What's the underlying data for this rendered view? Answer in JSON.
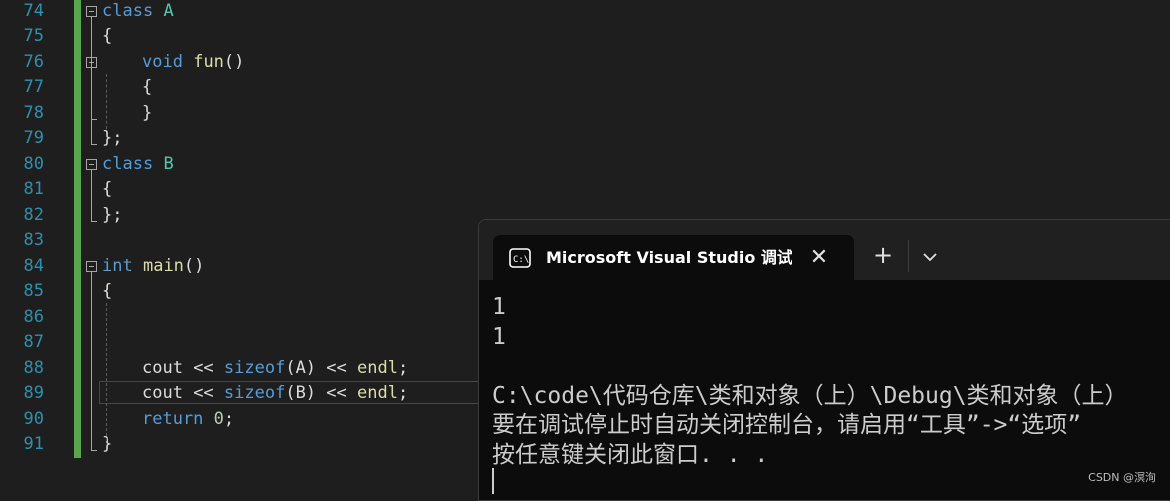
{
  "editor": {
    "lines": [
      {
        "num": "74",
        "indent": 0,
        "tokens": [
          {
            "t": "class",
            "k": "kw"
          },
          {
            "t": " ",
            "k": "txt"
          },
          {
            "t": "A",
            "k": "cls"
          }
        ]
      },
      {
        "num": "75",
        "indent": 0,
        "tokens": [
          {
            "t": "{",
            "k": "txt"
          }
        ]
      },
      {
        "num": "76",
        "indent": 1,
        "tokens": [
          {
            "t": "void",
            "k": "kw"
          },
          {
            "t": " ",
            "k": "txt"
          },
          {
            "t": "fun",
            "k": "fn"
          },
          {
            "t": "()",
            "k": "txt"
          }
        ]
      },
      {
        "num": "77",
        "indent": 1,
        "tokens": [
          {
            "t": "{",
            "k": "txt"
          }
        ]
      },
      {
        "num": "78",
        "indent": 1,
        "tokens": [
          {
            "t": "}",
            "k": "txt"
          }
        ]
      },
      {
        "num": "79",
        "indent": 0,
        "tokens": [
          {
            "t": "};",
            "k": "txt"
          }
        ]
      },
      {
        "num": "80",
        "indent": 0,
        "tokens": [
          {
            "t": "class",
            "k": "kw"
          },
          {
            "t": " ",
            "k": "txt"
          },
          {
            "t": "B",
            "k": "cls"
          }
        ]
      },
      {
        "num": "81",
        "indent": 0,
        "tokens": [
          {
            "t": "{",
            "k": "txt"
          }
        ]
      },
      {
        "num": "82",
        "indent": 0,
        "tokens": [
          {
            "t": "};",
            "k": "txt"
          }
        ]
      },
      {
        "num": "83",
        "indent": 0,
        "tokens": []
      },
      {
        "num": "84",
        "indent": 0,
        "tokens": [
          {
            "t": "int",
            "k": "kw"
          },
          {
            "t": " ",
            "k": "txt"
          },
          {
            "t": "main",
            "k": "fn"
          },
          {
            "t": "()",
            "k": "txt"
          }
        ]
      },
      {
        "num": "85",
        "indent": 0,
        "tokens": [
          {
            "t": "{",
            "k": "txt"
          }
        ]
      },
      {
        "num": "86",
        "indent": 0,
        "tokens": []
      },
      {
        "num": "87",
        "indent": 0,
        "tokens": []
      },
      {
        "num": "88",
        "indent": 1,
        "tokens": [
          {
            "t": "cout",
            "k": "txt"
          },
          {
            "t": " << ",
            "k": "txt"
          },
          {
            "t": "sizeof",
            "k": "kw"
          },
          {
            "t": "(A)",
            "k": "txt"
          },
          {
            "t": " << ",
            "k": "txt"
          },
          {
            "t": "endl",
            "k": "fn"
          },
          {
            "t": ";",
            "k": "txt"
          }
        ]
      },
      {
        "num": "89",
        "indent": 1,
        "tokens": [
          {
            "t": "cout",
            "k": "txt"
          },
          {
            "t": " << ",
            "k": "txt"
          },
          {
            "t": "sizeof",
            "k": "kw"
          },
          {
            "t": "(B)",
            "k": "txt"
          },
          {
            "t": " << ",
            "k": "txt"
          },
          {
            "t": "endl",
            "k": "fn"
          },
          {
            "t": ";",
            "k": "txt"
          }
        ]
      },
      {
        "num": "90",
        "indent": 1,
        "tokens": [
          {
            "t": "return",
            "k": "kw"
          },
          {
            "t": " ",
            "k": "txt"
          },
          {
            "t": "0",
            "k": "num"
          },
          {
            "t": ";",
            "k": "txt"
          }
        ]
      },
      {
        "num": "91",
        "indent": 0,
        "tokens": [
          {
            "t": "}",
            "k": "txt"
          }
        ]
      }
    ]
  },
  "terminal": {
    "tab_title": "Microsoft Visual Studio 调试控制台",
    "icon": "terminal-icon",
    "close_icon": "close-icon",
    "new_tab_label": "+",
    "dropdown_icon": "chevron-down-icon",
    "output": [
      "1",
      "1",
      "",
      "C:\\code\\代码仓库\\类和对象（上）\\Debug\\类和对象（上）",
      "要在调试停止时自动关闭控制台，请启用“工具”->“选项”",
      "按任意键关闭此窗口. . ."
    ]
  },
  "watermark": "CSDN @溟洵",
  "colors": {
    "editor_bg": "#1e1e1e",
    "line_number": "#2b91af",
    "keyword": "#569cd6",
    "class_name": "#4ec9b0",
    "function": "#dcdcaa",
    "change_bar": "#57a64a",
    "terminal_bg": "#0c0c0c"
  }
}
